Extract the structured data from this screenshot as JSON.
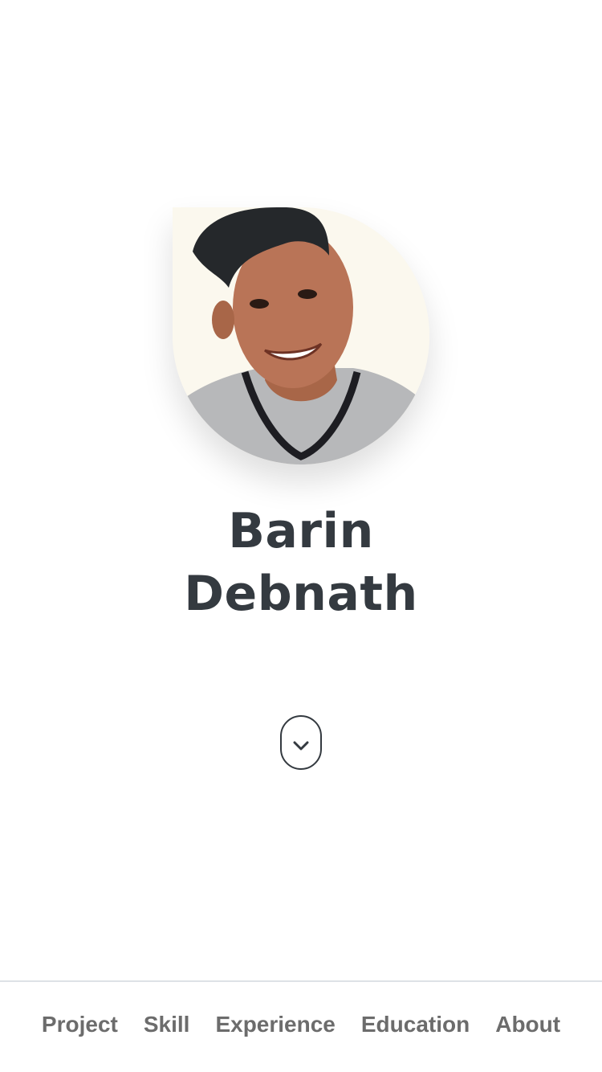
{
  "profile": {
    "first_name": "Barin",
    "last_name": "Debnath",
    "photo": "profile-photo"
  },
  "scroll": {
    "icon": "chevron-down-icon"
  },
  "nav": {
    "items": [
      {
        "label": "Project"
      },
      {
        "label": "Skill"
      },
      {
        "label": "Experience"
      },
      {
        "label": "Education"
      },
      {
        "label": "About"
      }
    ]
  },
  "colors": {
    "text_dark": "#343a40",
    "nav_text": "#6c6c6c",
    "divider": "#dee2e6",
    "background": "#ffffff"
  }
}
